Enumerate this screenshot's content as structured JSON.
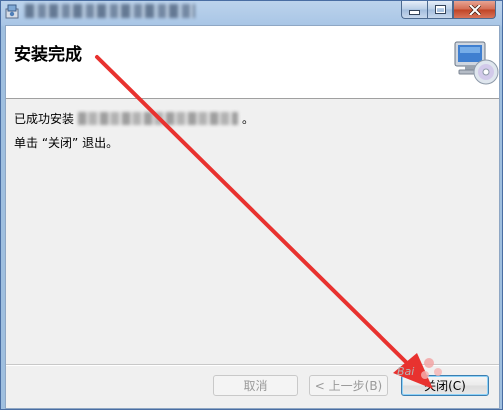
{
  "window": {
    "app_icon": "installer-icon",
    "title_buttons": {
      "minimize": "minimize-icon",
      "maximize": "maximize-icon",
      "close": "close-icon"
    }
  },
  "banner": {
    "title": "安装完成",
    "icon": "computer-cd-icon"
  },
  "body": {
    "success_prefix": "已成功安装",
    "success_suffix": "。",
    "instruction": "单击 “关闭” 退出。"
  },
  "buttons": {
    "cancel": "取消",
    "back": "< 上一步(B)",
    "close": "关闭(C)"
  },
  "overlay": {
    "arrow_color": "#e8322f",
    "watermark": "Bai"
  }
}
